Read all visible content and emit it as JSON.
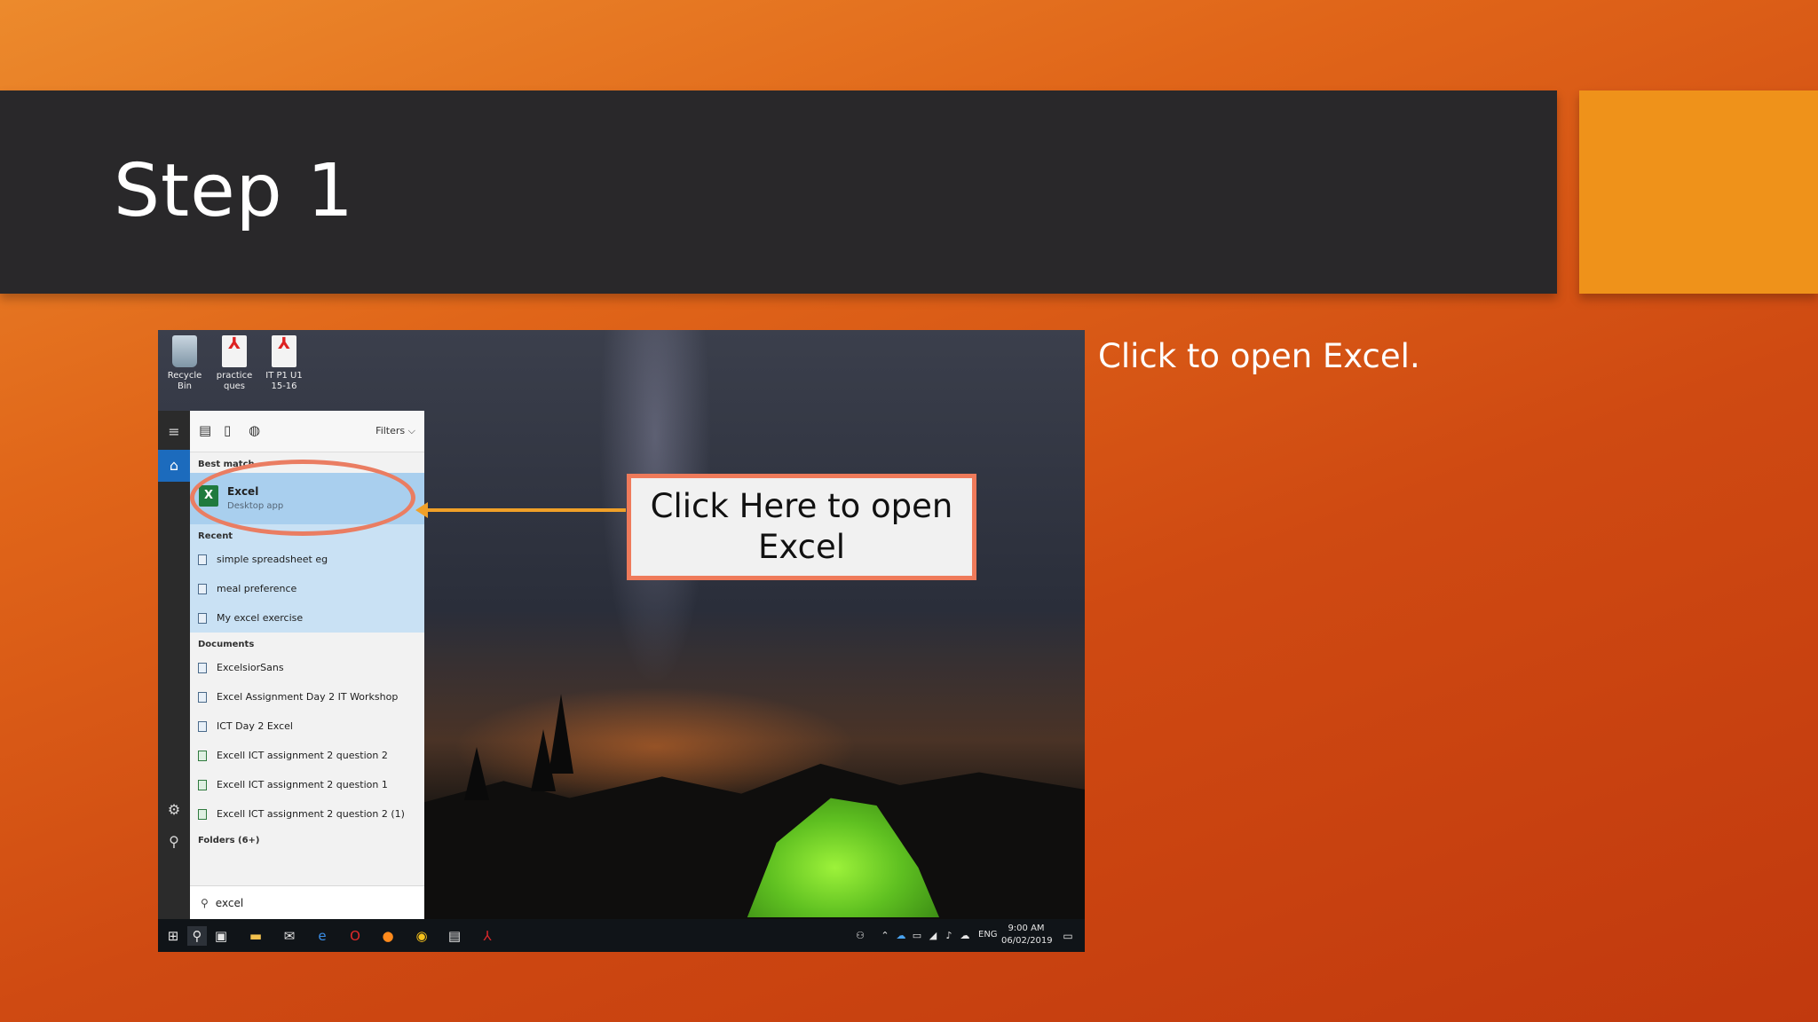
{
  "slide": {
    "title": "Step 1",
    "side_note": "Click to open Excel.",
    "callout": "Click Here to open Excel",
    "colors": {
      "title_bar": "#29282a",
      "accent": "#ef921a",
      "callout_border": "#ef7a5a",
      "arrow": "#f0a028"
    }
  },
  "desktop": {
    "icons": [
      {
        "label": "Recycle Bin",
        "icon": "recycle-bin-icon"
      },
      {
        "label": "practice ques",
        "icon": "pdf-file-icon"
      },
      {
        "label": "IT P1 U1 15-16",
        "icon": "pdf-file-icon"
      }
    ]
  },
  "start_menu": {
    "filters_label": "Filters",
    "best_match_heading": "Best match",
    "best_match": {
      "name": "Excel",
      "subtitle": "Desktop app"
    },
    "recent_heading": "Recent",
    "recent": [
      "simple spreadsheet eg",
      "meal preference",
      "My excel exercise"
    ],
    "documents_heading": "Documents",
    "documents": [
      "ExcelsiorSans",
      "Excel Assignment Day 2 IT Workshop",
      "ICT Day 2 Excel",
      "Excell ICT assignment 2 question 2",
      "Excell ICT assignment 2 question 1",
      "Excell ICT assignment 2 question 2 (1)"
    ],
    "folders_heading": "Folders (6+)",
    "search_value": "excel"
  },
  "taskbar": {
    "language": "ENG",
    "time": "9:00 AM",
    "date": "06/02/2019"
  }
}
